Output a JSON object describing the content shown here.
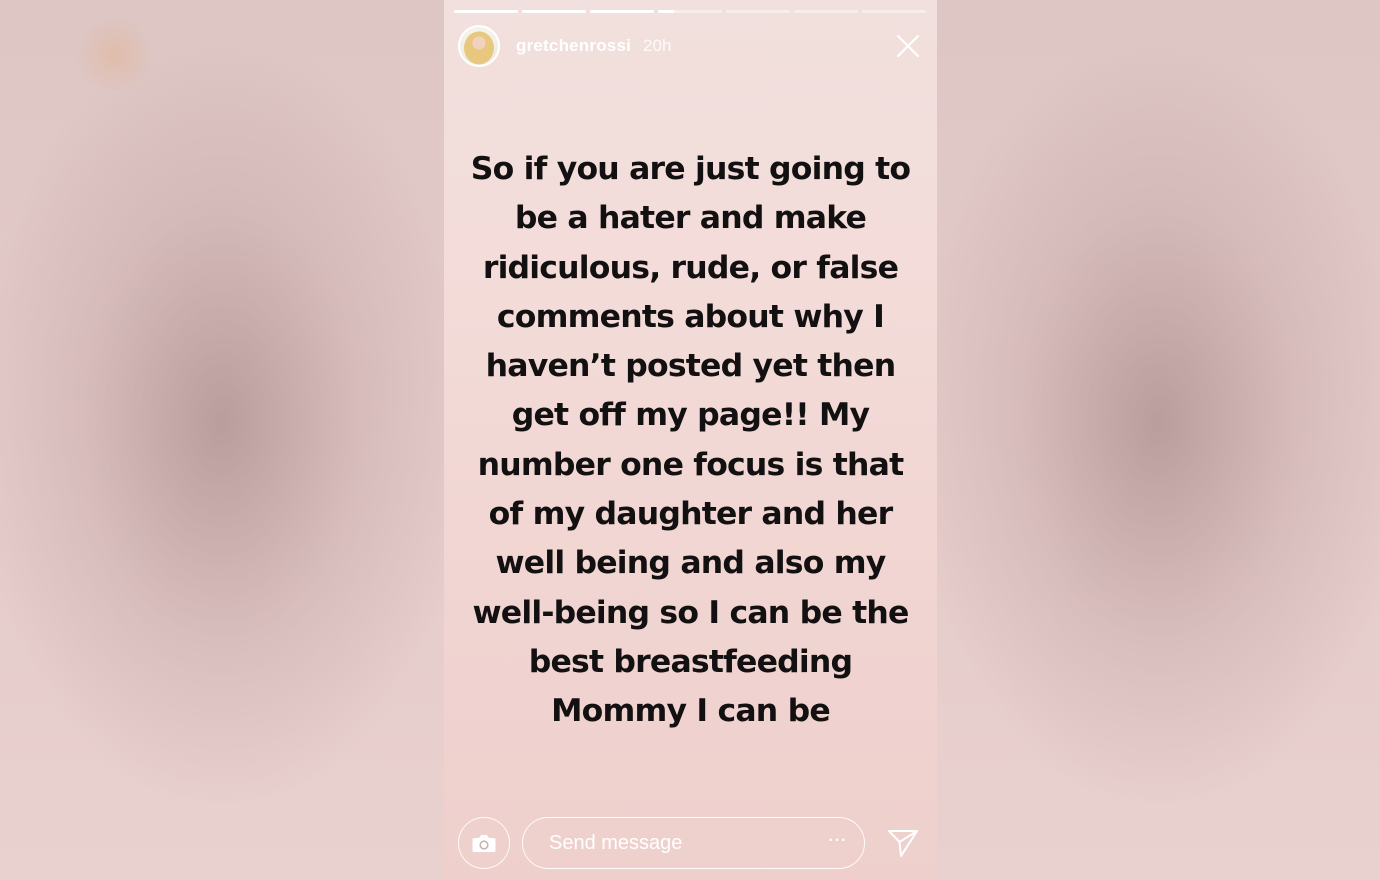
{
  "story": {
    "username": "gretchenrossi",
    "time_ago": "20h",
    "segments": [
      {
        "progress": 1.0
      },
      {
        "progress": 1.0
      },
      {
        "progress": 1.0
      },
      {
        "progress": 0.25
      },
      {
        "progress": 0.0
      },
      {
        "progress": 0.0
      },
      {
        "progress": 0.0
      }
    ],
    "message_lines": [
      "So if you are just going to",
      "be a hater and make",
      "ridiculous, rude, or false",
      "comments about why I",
      "haven’t posted yet then",
      "get off my page!!  My",
      "number one focus is that",
      "of my daughter and her",
      "well being and also my",
      "well-being so I can be the",
      "best breastfeeding",
      "Mommy I can be"
    ]
  },
  "footer": {
    "send_placeholder": "Send message",
    "more_label": "···"
  },
  "icons": {
    "close": "close-icon",
    "camera": "camera-icon",
    "more": "more-dots-icon",
    "share": "paper-plane-icon"
  },
  "colors": {
    "story_background": "#f1dad7",
    "message_text": "#121010",
    "ui_white": "#ffffff"
  }
}
